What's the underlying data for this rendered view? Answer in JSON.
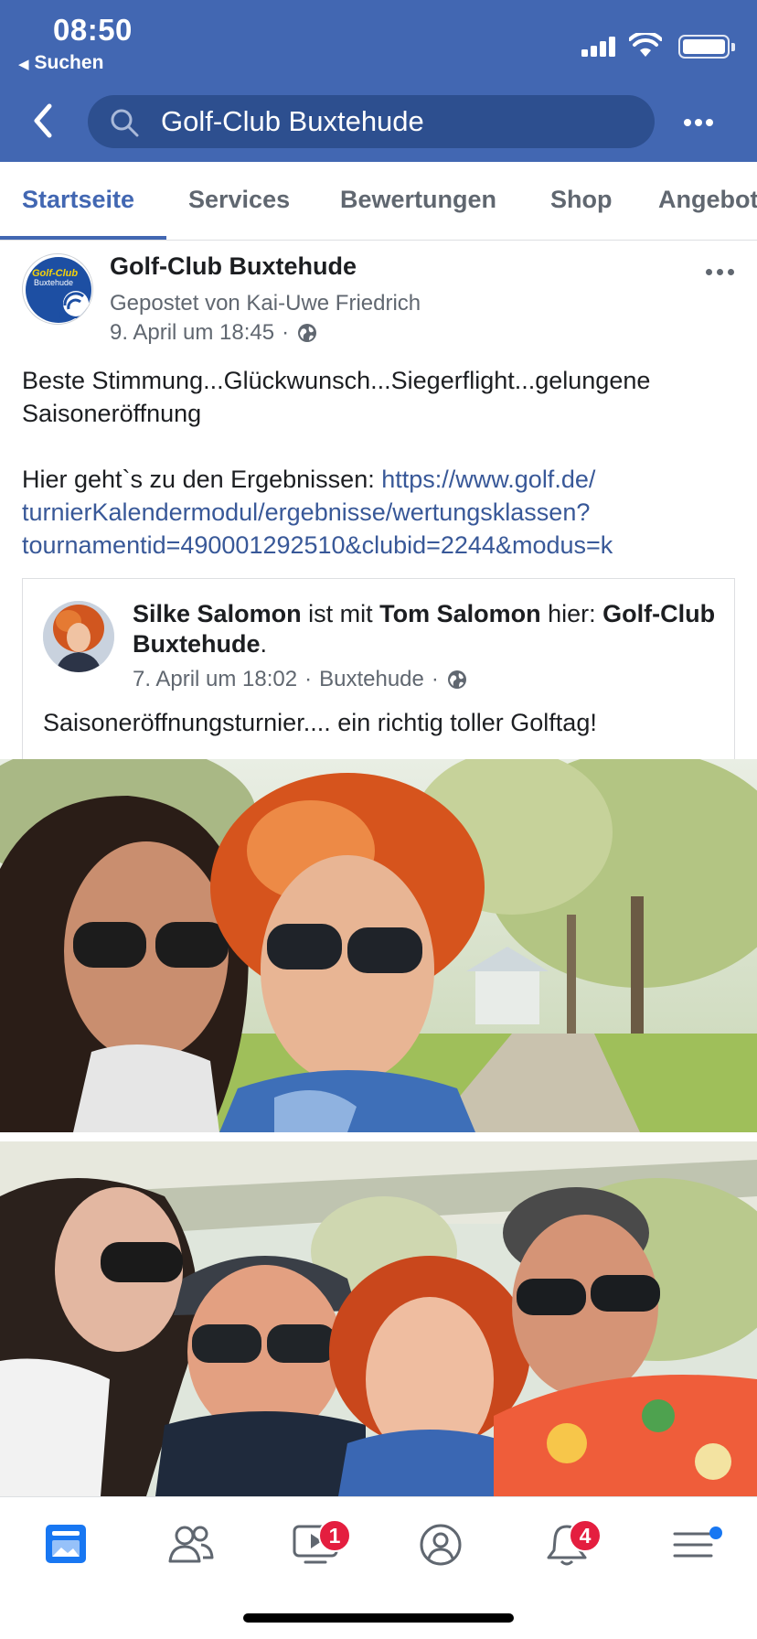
{
  "status_bar": {
    "time": "08:50",
    "back_app_label": "Suchen"
  },
  "header": {
    "search_text": "Golf-Club Buxtehude",
    "brand_color": "#4267b2"
  },
  "tabs": [
    {
      "label": "Startseite",
      "active": true
    },
    {
      "label": "Services",
      "active": false
    },
    {
      "label": "Bewertungen",
      "active": false
    },
    {
      "label": "Shop",
      "active": false
    },
    {
      "label": "Angebote",
      "active": false
    }
  ],
  "post": {
    "page_name": "Golf-Club Buxtehude",
    "logo_text_1": "Golf-Club",
    "logo_text_2": "Buxtehude",
    "posted_by": "Gepostet von Kai-Uwe Friedrich",
    "date": "9. April um 18:45",
    "separator": "·",
    "text_line_1": "Beste Stimmung...Glückwunsch...Siegerflight...gelungene Saisoneröffnung",
    "text_line_2": "Hier geht`s zu den Ergebnissen:",
    "link_part_1": "https://www.golf.de/",
    "link_part_2": "turnierKalendermodul/ergebnisse/wertungsklassen?",
    "link_part_3": "tournamentid=490001292510&clubid=2244&modus=k"
  },
  "shared_post": {
    "author": "Silke Salomon",
    "with_text": "ist mit",
    "with_person": "Tom Salomon",
    "here_text": "hier:",
    "location_name": "Golf-Club Buxtehude",
    "end_punct": ".",
    "date": "7. April um 18:02",
    "separator": "·",
    "place": "Buxtehude",
    "text": "Saisoneröffnungsturnier.... ein richtig toller Golftag!"
  },
  "bottom_nav": {
    "items": [
      {
        "icon": "news-feed-icon",
        "active": true
      },
      {
        "icon": "friends-icon",
        "active": false
      },
      {
        "icon": "watch-video-icon",
        "active": false,
        "badge": "1"
      },
      {
        "icon": "profile-icon",
        "active": false
      },
      {
        "icon": "notifications-bell-icon",
        "active": false,
        "badge": "4"
      },
      {
        "icon": "menu-icon",
        "active": false
      }
    ],
    "badge_color": "#e41e3f",
    "active_color": "#1877f2"
  }
}
